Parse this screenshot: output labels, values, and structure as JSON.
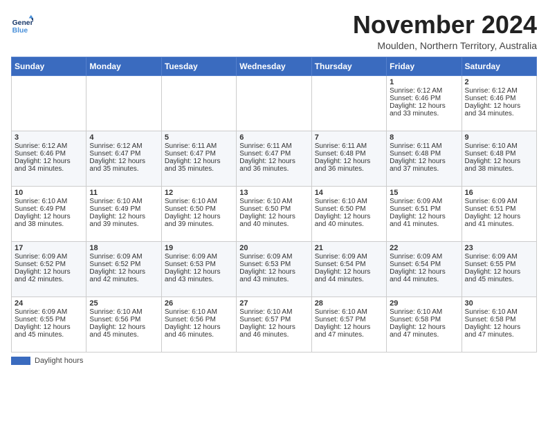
{
  "header": {
    "logo_line1": "General",
    "logo_line2": "Blue",
    "month": "November 2024",
    "location": "Moulden, Northern Territory, Australia"
  },
  "days_of_week": [
    "Sunday",
    "Monday",
    "Tuesday",
    "Wednesday",
    "Thursday",
    "Friday",
    "Saturday"
  ],
  "weeks": [
    [
      {
        "day": "",
        "text": ""
      },
      {
        "day": "",
        "text": ""
      },
      {
        "day": "",
        "text": ""
      },
      {
        "day": "",
        "text": ""
      },
      {
        "day": "",
        "text": ""
      },
      {
        "day": "1",
        "text": "Sunrise: 6:12 AM\nSunset: 6:46 PM\nDaylight: 12 hours and 33 minutes."
      },
      {
        "day": "2",
        "text": "Sunrise: 6:12 AM\nSunset: 6:46 PM\nDaylight: 12 hours and 34 minutes."
      }
    ],
    [
      {
        "day": "3",
        "text": "Sunrise: 6:12 AM\nSunset: 6:46 PM\nDaylight: 12 hours and 34 minutes."
      },
      {
        "day": "4",
        "text": "Sunrise: 6:12 AM\nSunset: 6:47 PM\nDaylight: 12 hours and 35 minutes."
      },
      {
        "day": "5",
        "text": "Sunrise: 6:11 AM\nSunset: 6:47 PM\nDaylight: 12 hours and 35 minutes."
      },
      {
        "day": "6",
        "text": "Sunrise: 6:11 AM\nSunset: 6:47 PM\nDaylight: 12 hours and 36 minutes."
      },
      {
        "day": "7",
        "text": "Sunrise: 6:11 AM\nSunset: 6:48 PM\nDaylight: 12 hours and 36 minutes."
      },
      {
        "day": "8",
        "text": "Sunrise: 6:11 AM\nSunset: 6:48 PM\nDaylight: 12 hours and 37 minutes."
      },
      {
        "day": "9",
        "text": "Sunrise: 6:10 AM\nSunset: 6:48 PM\nDaylight: 12 hours and 38 minutes."
      }
    ],
    [
      {
        "day": "10",
        "text": "Sunrise: 6:10 AM\nSunset: 6:49 PM\nDaylight: 12 hours and 38 minutes."
      },
      {
        "day": "11",
        "text": "Sunrise: 6:10 AM\nSunset: 6:49 PM\nDaylight: 12 hours and 39 minutes."
      },
      {
        "day": "12",
        "text": "Sunrise: 6:10 AM\nSunset: 6:50 PM\nDaylight: 12 hours and 39 minutes."
      },
      {
        "day": "13",
        "text": "Sunrise: 6:10 AM\nSunset: 6:50 PM\nDaylight: 12 hours and 40 minutes."
      },
      {
        "day": "14",
        "text": "Sunrise: 6:10 AM\nSunset: 6:50 PM\nDaylight: 12 hours and 40 minutes."
      },
      {
        "day": "15",
        "text": "Sunrise: 6:09 AM\nSunset: 6:51 PM\nDaylight: 12 hours and 41 minutes."
      },
      {
        "day": "16",
        "text": "Sunrise: 6:09 AM\nSunset: 6:51 PM\nDaylight: 12 hours and 41 minutes."
      }
    ],
    [
      {
        "day": "17",
        "text": "Sunrise: 6:09 AM\nSunset: 6:52 PM\nDaylight: 12 hours and 42 minutes."
      },
      {
        "day": "18",
        "text": "Sunrise: 6:09 AM\nSunset: 6:52 PM\nDaylight: 12 hours and 42 minutes."
      },
      {
        "day": "19",
        "text": "Sunrise: 6:09 AM\nSunset: 6:53 PM\nDaylight: 12 hours and 43 minutes."
      },
      {
        "day": "20",
        "text": "Sunrise: 6:09 AM\nSunset: 6:53 PM\nDaylight: 12 hours and 43 minutes."
      },
      {
        "day": "21",
        "text": "Sunrise: 6:09 AM\nSunset: 6:54 PM\nDaylight: 12 hours and 44 minutes."
      },
      {
        "day": "22",
        "text": "Sunrise: 6:09 AM\nSunset: 6:54 PM\nDaylight: 12 hours and 44 minutes."
      },
      {
        "day": "23",
        "text": "Sunrise: 6:09 AM\nSunset: 6:55 PM\nDaylight: 12 hours and 45 minutes."
      }
    ],
    [
      {
        "day": "24",
        "text": "Sunrise: 6:09 AM\nSunset: 6:55 PM\nDaylight: 12 hours and 45 minutes."
      },
      {
        "day": "25",
        "text": "Sunrise: 6:10 AM\nSunset: 6:56 PM\nDaylight: 12 hours and 45 minutes."
      },
      {
        "day": "26",
        "text": "Sunrise: 6:10 AM\nSunset: 6:56 PM\nDaylight: 12 hours and 46 minutes."
      },
      {
        "day": "27",
        "text": "Sunrise: 6:10 AM\nSunset: 6:57 PM\nDaylight: 12 hours and 46 minutes."
      },
      {
        "day": "28",
        "text": "Sunrise: 6:10 AM\nSunset: 6:57 PM\nDaylight: 12 hours and 47 minutes."
      },
      {
        "day": "29",
        "text": "Sunrise: 6:10 AM\nSunset: 6:58 PM\nDaylight: 12 hours and 47 minutes."
      },
      {
        "day": "30",
        "text": "Sunrise: 6:10 AM\nSunset: 6:58 PM\nDaylight: 12 hours and 47 minutes."
      }
    ]
  ],
  "legend": {
    "color_label": "Daylight hours"
  }
}
